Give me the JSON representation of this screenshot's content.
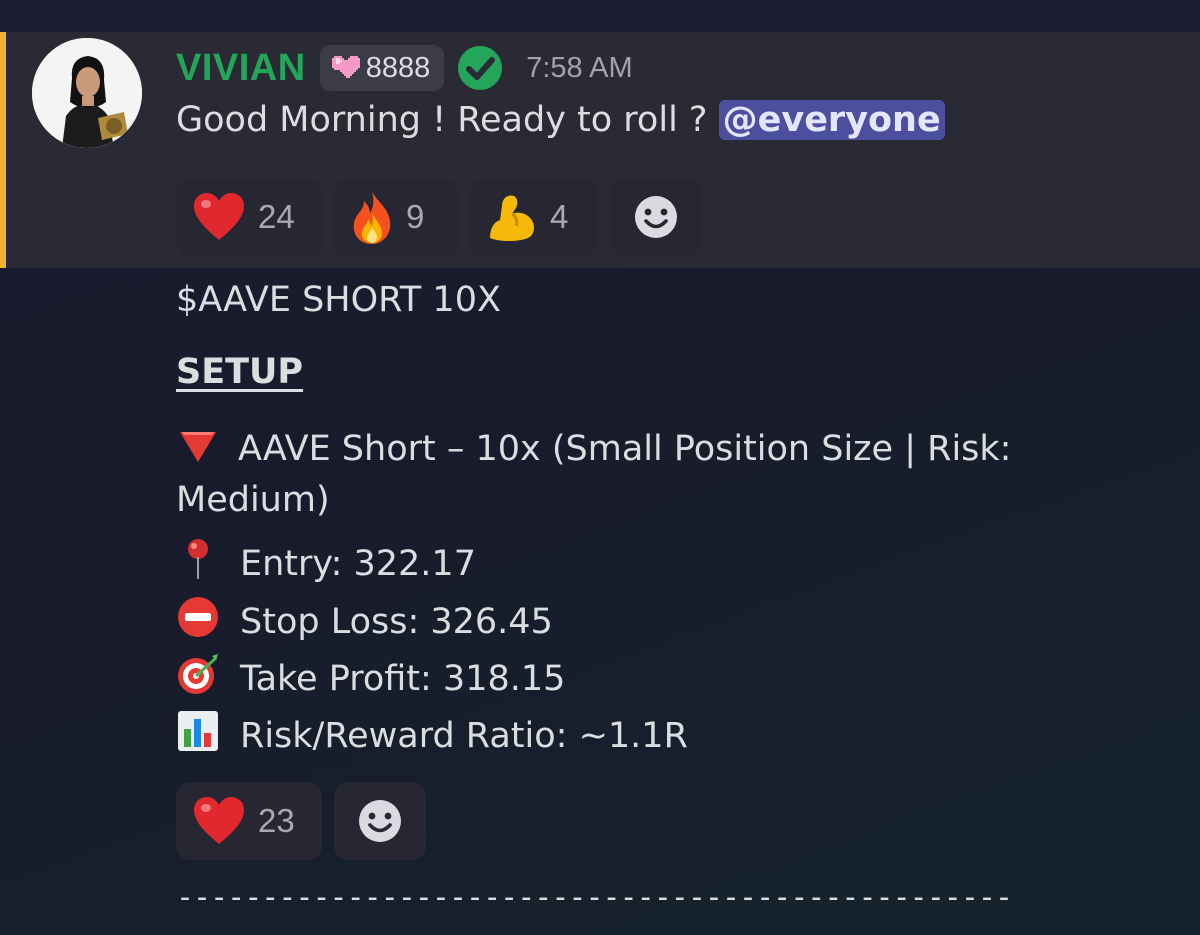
{
  "message1": {
    "username": "VIVIAN",
    "boost_count": "8888",
    "timestamp": "7:58 AM",
    "text": "Good Morning ! Ready to roll ?",
    "mention": "@everyone",
    "reactions": [
      {
        "emoji": "heart-icon",
        "count": "24"
      },
      {
        "emoji": "fire-icon",
        "count": "9"
      },
      {
        "emoji": "flexed-biceps-icon",
        "count": "4"
      }
    ]
  },
  "message2": {
    "title": "$AAVE SHORT 10X",
    "setup_heading": "SETUP",
    "line1": "AAVE Short – 10x (Small Position Size | Risk:",
    "line1b": "Medium)",
    "entry": "Entry: 322.17",
    "stop_loss": "Stop Loss: 326.45",
    "take_profit": "Take Profit: 318.15",
    "rr": "Risk/Reward Ratio: ~1.1R",
    "reactions": [
      {
        "emoji": "heart-icon",
        "count": "23"
      }
    ]
  },
  "divider": "-------------------------------------------------",
  "colors": {
    "username": "#23a55a",
    "highlight_bar": "#f0b232",
    "mention_bg": "#4c4f9e"
  }
}
